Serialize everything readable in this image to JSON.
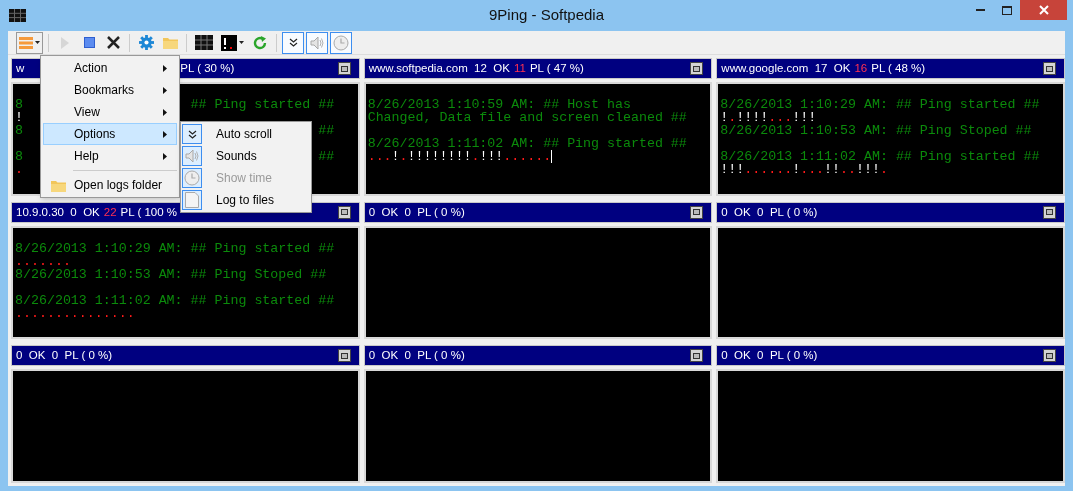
{
  "window": {
    "title": "9Ping - Softpedia"
  },
  "toolbar": {
    "buttons": [
      {
        "kind": "menu",
        "disabled": false
      },
      {
        "kind": "play",
        "disabled": true
      },
      {
        "kind": "stop",
        "disabled": false
      },
      {
        "kind": "delete",
        "disabled": false
      },
      {
        "kind": "settings",
        "disabled": false
      },
      {
        "kind": "folder",
        "disabled": false
      },
      {
        "kind": "grid",
        "disabled": false
      },
      {
        "kind": "console",
        "disabled": false
      },
      {
        "kind": "refresh",
        "disabled": false
      }
    ],
    "toggles": [
      {
        "kind": "autoscroll",
        "checked": true
      },
      {
        "kind": "sound",
        "checked": true
      },
      {
        "kind": "clock",
        "checked": true
      }
    ]
  },
  "menu": {
    "items": [
      {
        "kind": "submenu",
        "label": "Action",
        "selected": false
      },
      {
        "kind": "submenu",
        "label": "Bookmarks",
        "selected": false
      },
      {
        "kind": "submenu",
        "label": "View",
        "selected": false
      },
      {
        "kind": "submenu",
        "label": "Options",
        "selected": true
      },
      {
        "kind": "submenu",
        "label": "Help",
        "selected": false
      },
      {
        "kind": "separator"
      },
      {
        "kind": "folder",
        "label": "Open logs folder",
        "selected": false
      }
    ],
    "submenu": [
      {
        "label": "Auto scroll",
        "checked": true,
        "disabled": false
      },
      {
        "label": "Sounds",
        "checked": true,
        "disabled": false
      },
      {
        "label": "Show time",
        "checked": true,
        "disabled": true
      },
      {
        "label": "Log to files",
        "checked": true,
        "disabled": false
      }
    ]
  },
  "panels": [
    {
      "header": [
        {
          "kind": "text",
          "text": "w"
        },
        {
          "kind": "text",
          "text": "PL ( 30 %)"
        }
      ],
      "lines": [
        {
          "kind": "split",
          "left": [
            {
              "kind": "msg",
              "text": "8"
            }
          ],
          "right": [
            {
              "kind": "msg",
              "text": "## Ping started ##"
            }
          ]
        },
        {
          "kind": "entry",
          "segments": [
            {
              "kind": "ok",
              "text": "!"
            }
          ]
        },
        {
          "kind": "split",
          "left": [
            {
              "kind": "msg",
              "text": "8"
            }
          ],
          "right": [
            {
              "kind": "msg",
              "text": "##"
            }
          ]
        },
        {
          "kind": "blank"
        },
        {
          "kind": "split",
          "left": [
            {
              "kind": "msg",
              "text": "8"
            }
          ],
          "right": [
            {
              "kind": "msg",
              "text": "##"
            }
          ]
        },
        {
          "kind": "entry",
          "segments": [
            {
              "kind": "fail",
              "text": "."
            }
          ]
        }
      ]
    },
    {
      "header": [
        {
          "kind": "text",
          "text": "www.softpedia.com  12  OK"
        },
        {
          "kind": "fail",
          "text": "11"
        },
        {
          "kind": "text",
          "text": "PL ( 47 %)"
        }
      ],
      "lines": [
        {
          "kind": "entry",
          "segments": [
            {
              "kind": "msg",
              "text": "8/26/2013 1:10:59 AM: ## Host has"
            }
          ]
        },
        {
          "kind": "entry",
          "segments": [
            {
              "kind": "msg",
              "text": "Changed, Data file and screen cleaned ##"
            }
          ]
        },
        {
          "kind": "blank"
        },
        {
          "kind": "entry",
          "segments": [
            {
              "kind": "msg",
              "text": "8/26/2013 1:11:02 AM: ## Ping started ##"
            }
          ]
        },
        {
          "kind": "entry",
          "segments": [
            {
              "kind": "fail",
              "text": "..."
            },
            {
              "kind": "ok",
              "text": "!"
            },
            {
              "kind": "fail",
              "text": "."
            },
            {
              "kind": "ok",
              "text": "!!!!!!!!"
            },
            {
              "kind": "fail",
              "text": "."
            },
            {
              "kind": "ok",
              "text": "!!!"
            },
            {
              "kind": "fail",
              "text": "......"
            },
            {
              "kind": "cursor"
            }
          ]
        }
      ]
    },
    {
      "header": [
        {
          "kind": "text",
          "text": "www.google.com  17  OK"
        },
        {
          "kind": "fail",
          "text": "16"
        },
        {
          "kind": "text",
          "text": "PL ( 48 %)"
        }
      ],
      "lines": [
        {
          "kind": "entry",
          "segments": [
            {
              "kind": "msg",
              "text": "8/26/2013 1:10:29 AM: ## Ping started ##"
            }
          ]
        },
        {
          "kind": "entry",
          "segments": [
            {
              "kind": "ok",
              "text": "!"
            },
            {
              "kind": "fail",
              "text": "."
            },
            {
              "kind": "ok",
              "text": "!!!!"
            },
            {
              "kind": "fail",
              "text": "..."
            },
            {
              "kind": "ok",
              "text": "!!!"
            }
          ]
        },
        {
          "kind": "entry",
          "segments": [
            {
              "kind": "msg",
              "text": "8/26/2013 1:10:53 AM: ## Ping Stoped ##"
            }
          ]
        },
        {
          "kind": "blank"
        },
        {
          "kind": "entry",
          "segments": [
            {
              "kind": "msg",
              "text": "8/26/2013 1:11:02 AM: ## Ping started ##"
            }
          ]
        },
        {
          "kind": "entry",
          "segments": [
            {
              "kind": "ok",
              "text": "!!!"
            },
            {
              "kind": "fail",
              "text": "......"
            },
            {
              "kind": "ok",
              "text": "!"
            },
            {
              "kind": "fail",
              "text": "..."
            },
            {
              "kind": "ok",
              "text": "!!"
            },
            {
              "kind": "fail",
              "text": ".."
            },
            {
              "kind": "ok",
              "text": "!!!"
            },
            {
              "kind": "fail",
              "text": "."
            }
          ]
        }
      ]
    },
    {
      "header": [
        {
          "kind": "text",
          "text": "10.9.0.30  0  OK"
        },
        {
          "kind": "fail",
          "text": "22"
        },
        {
          "kind": "text",
          "text": "PL ( 100 %"
        }
      ],
      "lines": [
        {
          "kind": "entry",
          "segments": [
            {
              "kind": "msg",
              "text": "8/26/2013 1:10:29 AM: ## Ping started ##"
            }
          ]
        },
        {
          "kind": "entry",
          "segments": [
            {
              "kind": "fail",
              "text": "......."
            }
          ]
        },
        {
          "kind": "entry",
          "segments": [
            {
              "kind": "msg",
              "text": "8/26/2013 1:10:53 AM: ## Ping Stoped ##"
            }
          ]
        },
        {
          "kind": "blank"
        },
        {
          "kind": "entry",
          "segments": [
            {
              "kind": "msg",
              "text": "8/26/2013 1:11:02 AM: ## Ping started ##"
            }
          ]
        },
        {
          "kind": "entry",
          "segments": [
            {
              "kind": "fail",
              "text": "..............."
            }
          ]
        }
      ]
    },
    {
      "header": [
        {
          "kind": "text",
          "text": "0  OK  0  PL ( 0 %)"
        }
      ]
    },
    {
      "header": [
        {
          "kind": "text",
          "text": "0  OK  0  PL ( 0 %)"
        }
      ]
    },
    {
      "header": [
        {
          "kind": "text",
          "text": "0  OK  0  PL ( 0 %)"
        }
      ]
    },
    {
      "header": [
        {
          "kind": "text",
          "text": "0  OK  0  PL ( 0 %)"
        }
      ]
    },
    {
      "header": [
        {
          "kind": "text",
          "text": "0  OK  0  PL ( 0 %)"
        }
      ]
    }
  ]
}
